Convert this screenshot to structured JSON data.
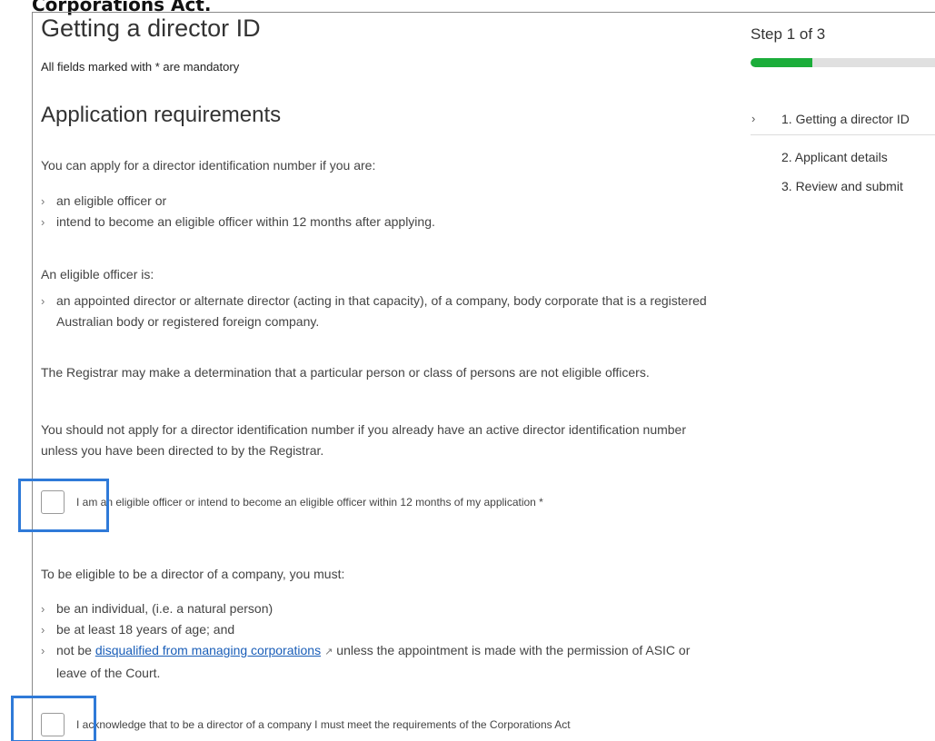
{
  "header": {
    "cropped_text": "Corporations Act.",
    "title": "Getting a director ID",
    "mandatory_note": "All fields marked with * are mandatory"
  },
  "section": {
    "title": "Application requirements",
    "intro": "You can apply for a director identification number if you are:",
    "eligibility_bullets": [
      "an eligible officer or",
      "intend to become an eligible officer within 12 months after applying."
    ],
    "officer_intro": "An eligible officer is:",
    "officer_bullets": [
      "an appointed director or alternate director (acting in that capacity), of a company, body corporate that is a registered Australian body or registered foreign company."
    ],
    "registrar_note": "The Registrar may make a determination that a particular person or class of persons are not eligible officers.",
    "active_note": "You should not apply for a director identification number if you already have an active director identification number unless you have been directed to by the Registrar."
  },
  "checkbox1": {
    "label": "I am an eligible officer or intend to become an eligible officer within 12 months of my application *",
    "checked": false
  },
  "director": {
    "intro": "To be eligible to be a director of a company, you must:",
    "bullet1": "be an individual, (i.e. a natural person)",
    "bullet2": "be at least 18 years of age; and",
    "bullet3_prefix": "not be",
    "bullet3_link": "disqualified from managing corporations",
    "bullet3_suffix": "unless the appointment is made with the permission of ASIC or leave of the Court."
  },
  "checkbox2": {
    "label": "I acknowledge that to be a director of a company I must meet the requirements of the Corporations Act",
    "checked": false
  },
  "sidebar": {
    "step_label": "Step 1 of 3",
    "progress_fraction": 0.3333,
    "progress_color": "#1bad3a",
    "steps": [
      {
        "label": "1. Getting a director ID",
        "current": true
      },
      {
        "label": "2. Applicant details",
        "current": false
      },
      {
        "label": "3. Review and submit",
        "current": false
      }
    ]
  },
  "colors": {
    "highlight": "#2f7ad8",
    "link": "#1a5eb8"
  },
  "icons": {
    "chevron": "chevron-right-icon",
    "external_link": "external-link-icon"
  }
}
